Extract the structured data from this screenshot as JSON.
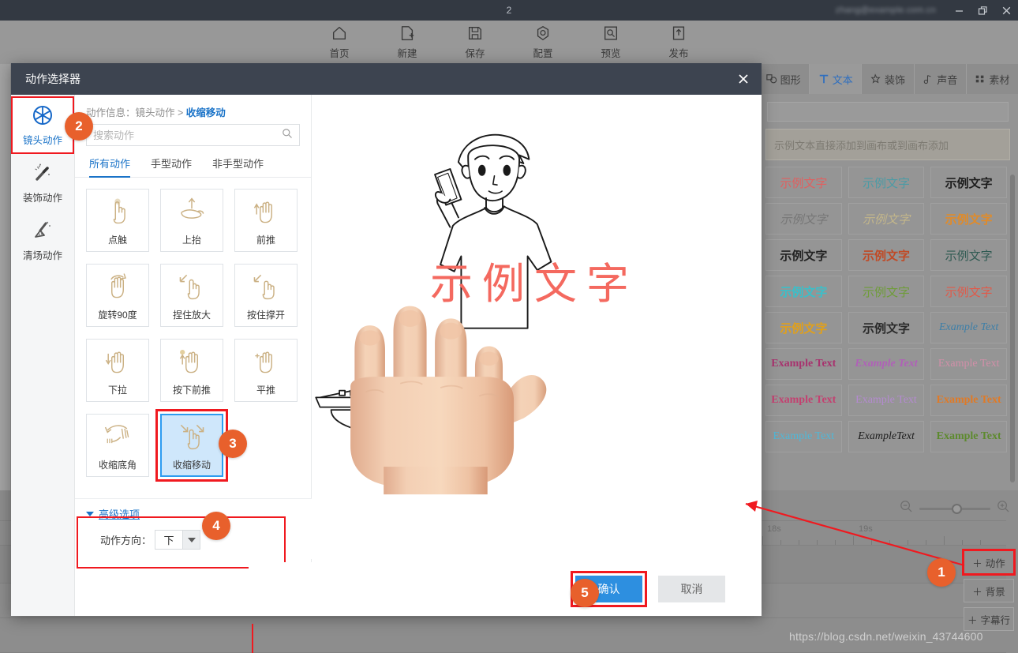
{
  "window": {
    "doc_number": "2",
    "account_blurred": "zhang@example.com.cn",
    "minimize": "—",
    "restore": "❐",
    "close": "✕"
  },
  "toolbar": {
    "items": [
      {
        "label": "首页",
        "icon": "home-icon"
      },
      {
        "label": "新建",
        "icon": "new-file-icon"
      },
      {
        "label": "保存",
        "icon": "save-icon"
      },
      {
        "label": "配置",
        "icon": "settings-icon"
      },
      {
        "label": "预览",
        "icon": "preview-icon"
      },
      {
        "label": "发布",
        "icon": "publish-icon"
      }
    ]
  },
  "dialog": {
    "title": "动作选择器",
    "close_label": "✕",
    "nav": [
      {
        "label": "镜头动作",
        "icon": "aperture-icon",
        "active": true
      },
      {
        "label": "装饰动作",
        "icon": "magic-wand-icon",
        "active": false
      },
      {
        "label": "清场动作",
        "icon": "broom-icon",
        "active": false
      }
    ],
    "breadcrumb": {
      "prefix": "动作信息：镜头动作 >",
      "current": "收缩移动"
    },
    "search": {
      "placeholder": "搜索动作",
      "value": "",
      "icon": "search-icon"
    },
    "tabs": [
      {
        "label": "所有动作",
        "active": true
      },
      {
        "label": "手型动作",
        "active": false
      },
      {
        "label": "非手型动作",
        "active": false
      }
    ],
    "actions": [
      {
        "label": "点触",
        "icon": "tap-hand-icon",
        "selected": false
      },
      {
        "label": "上抬",
        "icon": "lift-up-hand-icon",
        "selected": false
      },
      {
        "label": "前推",
        "icon": "push-forward-hand-icon",
        "selected": false
      },
      {
        "label": "旋转90度",
        "icon": "rotate-90-hand-icon",
        "selected": false
      },
      {
        "label": "捏住放大",
        "icon": "pinch-zoom-hand-icon",
        "selected": false
      },
      {
        "label": "按住撑开",
        "icon": "hold-spread-hand-icon",
        "selected": false
      },
      {
        "label": "下拉",
        "icon": "pull-down-hand-icon",
        "selected": false
      },
      {
        "label": "按下前推",
        "icon": "press-push-hand-icon",
        "selected": false
      },
      {
        "label": "平推",
        "icon": "flat-push-hand-icon",
        "selected": false
      },
      {
        "label": "收缩底角",
        "icon": "shrink-corner-hand-icon",
        "selected": false
      },
      {
        "label": "收缩移动",
        "icon": "shrink-move-hand-icon",
        "selected": true
      }
    ],
    "advanced": {
      "title": "高级选项",
      "direction_label": "动作方向：",
      "direction_value": "下"
    },
    "preview": {
      "sample_text": "示例文字",
      "sample_text_color": "#f4695f"
    },
    "footer": {
      "confirm": "确认",
      "cancel": "取消"
    }
  },
  "right_panel": {
    "tabs": [
      {
        "label": "图形",
        "icon": "shapes-icon",
        "active": false
      },
      {
        "label": "文本",
        "icon": "text-T-icon",
        "active": true
      },
      {
        "label": "装饰",
        "icon": "decorate-icon",
        "active": false
      },
      {
        "label": "声音",
        "icon": "sound-icon",
        "active": false
      },
      {
        "label": "素材",
        "icon": "material-grid-icon",
        "active": false
      }
    ],
    "banner": "示例文本直接添加到画布或到画布添加",
    "style_cells": [
      {
        "text": "示例文字",
        "color": "#e06060",
        "style": "normal",
        "weight": "normal"
      },
      {
        "text": "示例文字",
        "color": "#4d9ba5",
        "style": "normal",
        "weight": "normal"
      },
      {
        "text": "示例文字",
        "color": "#1d1d1d",
        "style": "normal",
        "weight": "bold"
      },
      {
        "text": "示例文字",
        "color": "#777777",
        "style": "italic",
        "weight": "normal"
      },
      {
        "text": "示例文字",
        "color": "#c3b68a",
        "style": "italic",
        "weight": "normal"
      },
      {
        "text": "示例文字",
        "color": "#e08b2a",
        "style": "normal",
        "weight": "bold"
      },
      {
        "text": "示例文字",
        "color": "#222222",
        "style": "normal",
        "weight": "bold"
      },
      {
        "text": "示例文字",
        "color": "#c04a26",
        "style": "normal",
        "weight": "bold"
      },
      {
        "text": "示例文字",
        "color": "#2f5a52",
        "style": "normal",
        "weight": "normal"
      },
      {
        "text": "示例文字",
        "color": "#3bbfc9",
        "style": "normal",
        "weight": "bold"
      },
      {
        "text": "示例文字",
        "color": "#6f9c3a",
        "style": "normal",
        "weight": "normal"
      },
      {
        "text": "示例文字",
        "color": "#e05a4a",
        "style": "normal",
        "weight": "normal"
      },
      {
        "text": "示例文字",
        "color": "#e0a01c",
        "style": "normal",
        "weight": "bold"
      },
      {
        "text": "示例文字",
        "color": "#2b2b2b",
        "style": "normal",
        "weight": "bold"
      },
      {
        "text": "Example Text",
        "color": "#3d7fa8",
        "style": "italic",
        "weight": "normal"
      },
      {
        "text": "Example Text",
        "color": "#a8326e",
        "style": "normal",
        "weight": "bold"
      },
      {
        "text": "Example Text",
        "color": "#b060b8",
        "style": "italic",
        "weight": "bold"
      },
      {
        "text": "Example Text",
        "color": "#d18fa8",
        "style": "normal",
        "weight": "normal"
      },
      {
        "text": "Example Text",
        "color": "#c44070",
        "style": "normal",
        "weight": "bold"
      },
      {
        "text": "Example Text",
        "color": "#b48ad0",
        "style": "normal",
        "weight": "normal"
      },
      {
        "text": "Example Text",
        "color": "#e07a26",
        "style": "normal",
        "weight": "bold"
      },
      {
        "text": "Example Text",
        "color": "#4fb8d8",
        "style": "normal",
        "weight": "normal"
      },
      {
        "text": "ExampleText",
        "color": "#1d1d1d",
        "style": "italic",
        "weight": "normal"
      },
      {
        "text": "Example Text",
        "color": "#5d8a2e",
        "style": "normal",
        "weight": "bold"
      }
    ]
  },
  "timeline": {
    "ruler_labels": [
      "18s",
      "19s"
    ],
    "zoom_out_icon": "zoom-out-icon",
    "zoom_in_icon": "zoom-in-icon",
    "zoom_position_pct": 46,
    "add_buttons": [
      {
        "label": "动作",
        "highlighted": true
      },
      {
        "label": "背景",
        "highlighted": false
      },
      {
        "label": "字幕行",
        "highlighted": false
      }
    ]
  },
  "annotations": {
    "steps": [
      "1",
      "2",
      "3",
      "4",
      "5"
    ]
  },
  "watermark": "https://blog.csdn.net/weixin_43744600"
}
